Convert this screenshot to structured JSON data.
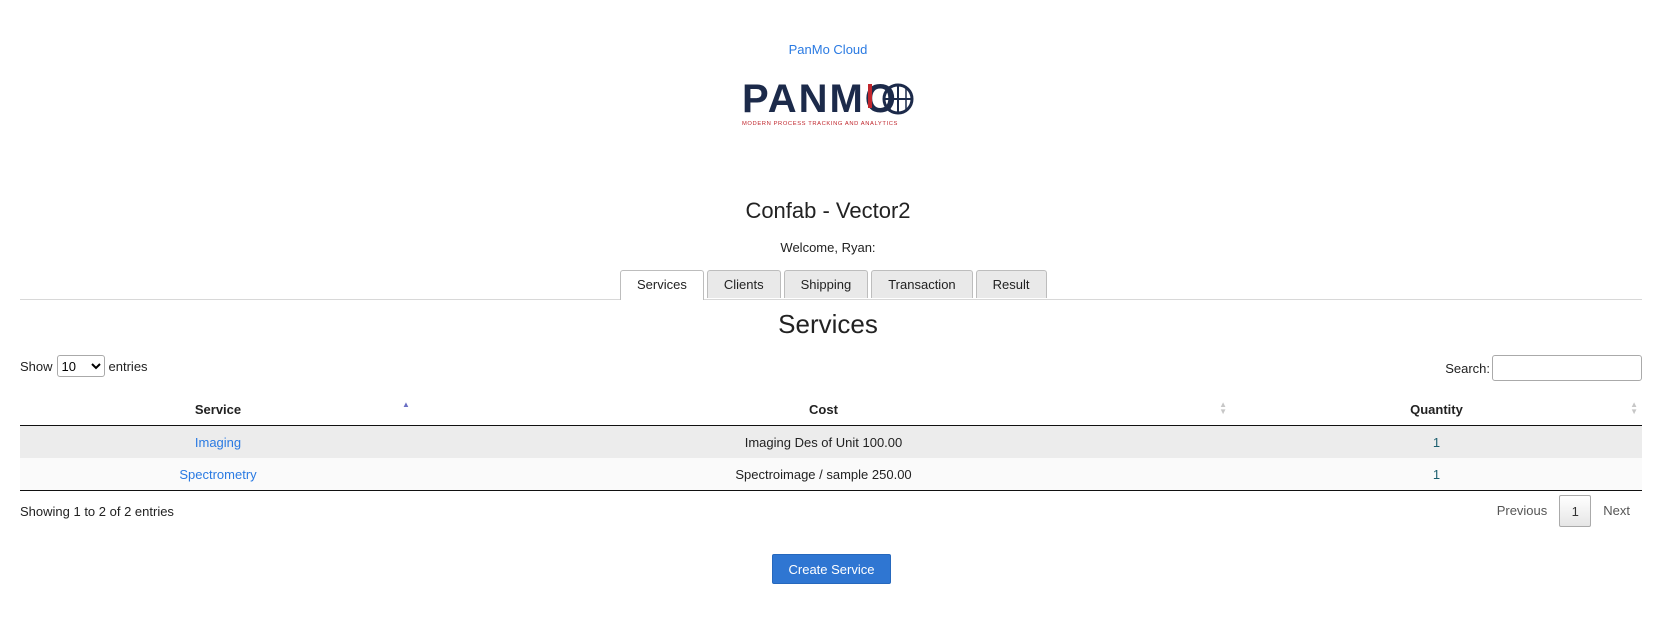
{
  "header": {
    "brand_link": "PanMo Cloud",
    "logo_text": "PANMO",
    "logo_tagline": "MODERN PROCESS TRACKING AND ANALYTICS",
    "app_title": "Confab - Vector2",
    "welcome": "Welcome, Ryan:"
  },
  "tabs": [
    {
      "label": "Services",
      "active": true
    },
    {
      "label": "Clients",
      "active": false
    },
    {
      "label": "Shipping",
      "active": false
    },
    {
      "label": "Transaction",
      "active": false
    },
    {
      "label": "Result",
      "active": false
    }
  ],
  "main": {
    "section_title": "Services",
    "length": {
      "show_label": "Show",
      "selected": "10",
      "entries_label": "entries"
    },
    "search": {
      "label": "Search:",
      "value": "",
      "placeholder": ""
    },
    "table": {
      "columns": [
        "Service",
        "Cost",
        "Quantity"
      ],
      "rows": [
        {
          "service": "Imaging",
          "cost": "Imaging Des of Unit 100.00",
          "quantity": "1"
        },
        {
          "service": "Spectrometry",
          "cost": "Spectroimage / sample 250.00",
          "quantity": "1"
        }
      ]
    },
    "info": "Showing 1 to 2 of 2 entries",
    "pagination": {
      "previous": "Previous",
      "page": "1",
      "next": "Next"
    },
    "create_button": "Create Service"
  },
  "colors": {
    "accent": "#2f76d2",
    "link": "#2a7ae2",
    "logo_navy": "#1c2a4a",
    "logo_red": "#c0262d"
  }
}
